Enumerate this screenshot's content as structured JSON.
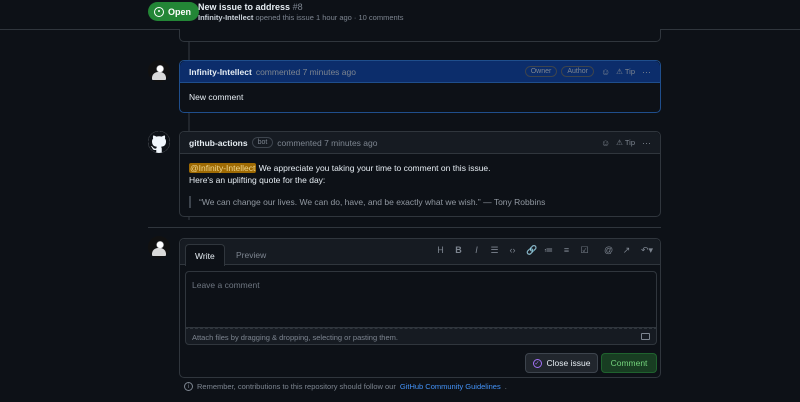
{
  "issue": {
    "state": "Open",
    "title": "New issue to address",
    "number": "#8",
    "author": "Infinity-Intellect",
    "meta_text": "opened this issue 1 hour ago · 10 comments"
  },
  "comments": [
    {
      "author": "Infinity-Intellect",
      "action": "commented 7 minutes ago",
      "labels": [
        "Owner",
        "Author"
      ],
      "tip": "Tip",
      "body": "New comment"
    },
    {
      "author": "github-actions",
      "bot_label": "bot",
      "action": "commented 7 minutes ago",
      "tip": "Tip",
      "mention": "@Infinity-Intellect",
      "line1": " We appreciate you taking your time to comment on this issue.",
      "line2": "Here's an uplifting quote for the day:",
      "quote": "“We can change our lives. We can do, have, and be exactly what we wish.” — Tony Robbins"
    }
  ],
  "editor": {
    "tab_write": "Write",
    "tab_preview": "Preview",
    "placeholder": "Leave a comment",
    "attach_text": "Attach files by dragging & dropping, selecting or pasting them.",
    "close_label": "Close issue",
    "comment_label": "Comment",
    "toolbar_icons": [
      "heading-icon",
      "bold-icon",
      "italic-icon",
      "quote-icon",
      "code-icon",
      "link-icon",
      "unordered-list-icon",
      "ordered-list-icon",
      "task-list-icon",
      "mention-icon",
      "reference-icon",
      "undo-icon"
    ]
  },
  "footer": {
    "note_text": "Remember, contributions to this repository should follow our",
    "link_text": "GitHub Community Guidelines",
    "period": "."
  },
  "colors": {
    "open_green": "#238636",
    "owner_header": "#0c2d6b",
    "link_blue": "#4493f8",
    "mention_bg": "#9e6a03"
  }
}
